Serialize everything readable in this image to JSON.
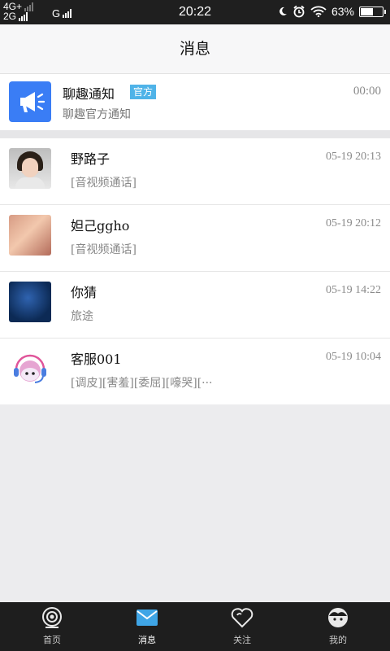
{
  "status_bar": {
    "network_top": "4G+",
    "network_bottom": "2G",
    "network_g": "G",
    "time": "20:22",
    "battery": "63%",
    "battery_level": 0.63,
    "icons": [
      "moon-icon",
      "alarm-icon",
      "wifi-icon",
      "battery-icon"
    ]
  },
  "header": {
    "title": "消息"
  },
  "official": {
    "name": "聊趣通知",
    "badge": "官方",
    "time": "00:00",
    "subtitle": "聊趣官方通知",
    "icon": "megaphone-icon",
    "icon_color": "#3a7df5"
  },
  "conversations": [
    {
      "name": "野路子",
      "time": "05-19 20:13",
      "preview": "[音视频通话]"
    },
    {
      "name": "妲己ggho",
      "time": "05-19 20:12",
      "preview": "[音视频通话]"
    },
    {
      "name": "你猜",
      "time": "05-19 14:22",
      "preview": "旅途"
    },
    {
      "name": "客服001",
      "time": "05-19 10:04",
      "preview": "[调皮][害羞][委屈][嚎哭][···"
    }
  ],
  "tabs": [
    {
      "label": "首页",
      "icon": "home-icon"
    },
    {
      "label": "消息",
      "icon": "message-icon",
      "active": true
    },
    {
      "label": "关注",
      "icon": "heart-icon"
    },
    {
      "label": "我的",
      "icon": "profile-icon"
    }
  ],
  "colors": {
    "accent": "#3a7df5",
    "badge": "#4fb3e8",
    "tab_active": "#3fa5e6"
  }
}
